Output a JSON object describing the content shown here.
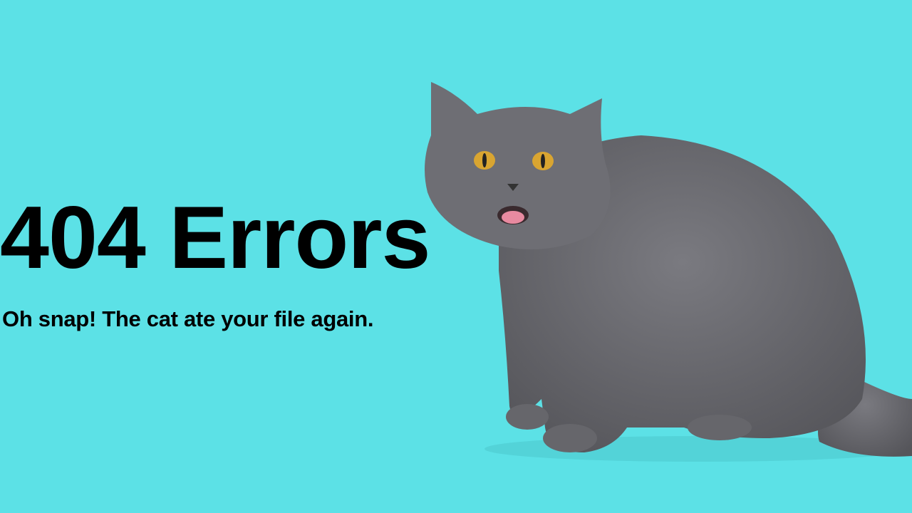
{
  "colors": {
    "background": "#5ce1e6",
    "text": "#000000",
    "cat_fur": "#6b6b70",
    "cat_eyes": "#d9a531"
  },
  "heading": "404 Errors",
  "message": "Oh snap! The cat ate your file again.",
  "image": {
    "subject": "cat-photo"
  }
}
